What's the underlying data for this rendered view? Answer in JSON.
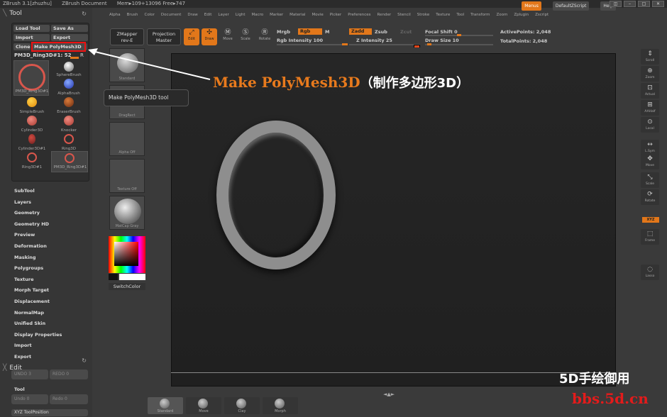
{
  "titlebar": {
    "app": "ZBrush 3.1[zhuzhu]",
    "doc": "ZBrush Document",
    "mem": "Mem▸109+13096 Free▸747"
  },
  "topright": {
    "menus": "Menus",
    "script": "DefaultZScript",
    "help": "Help"
  },
  "menubar": [
    "Alpha",
    "Brush",
    "Color",
    "Document",
    "Draw",
    "Edit",
    "Layer",
    "Light",
    "Macro",
    "Marker",
    "Material",
    "Movie",
    "Picker",
    "Preferences",
    "Render",
    "Stencil",
    "Stroke",
    "Texture",
    "Tool",
    "Transform",
    "Zoom",
    "Zplugin",
    "Zscript"
  ],
  "tool_panel": {
    "title": "Tool",
    "load": "Load Tool",
    "save": "Save As",
    "import": "Import",
    "export": "Export",
    "clone": "Clone",
    "make_polymesh": "Make PolyMesh3D",
    "current": "PM3D_Ring3D#1: 52",
    "r": "R",
    "thumb_label": "PM3D_Ring3D#1",
    "items": [
      {
        "label": "SphereBrush"
      },
      {
        "label": "AlphaBrush"
      },
      {
        "label": "SimpleBrush"
      },
      {
        "label": "EraserBrush"
      },
      {
        "label": "Cylinder3D"
      },
      {
        "label": "Knocker"
      },
      {
        "label": "Cylinder3D#1"
      },
      {
        "label": "Ring3D"
      },
      {
        "label": "Ring3D#1"
      },
      {
        "label": "PM3D_Ring3D#1"
      }
    ]
  },
  "tool_menu": [
    "SubTool",
    "Layers",
    "Geometry",
    "Geometry HD",
    "Preview",
    "Deformation",
    "Masking",
    "Polygroups",
    "Texture",
    "Morph Target",
    "Displacement",
    "NormalMap",
    "Unified Skin",
    "Display Properties",
    "Import",
    "Export"
  ],
  "edit_panel": {
    "title": "Edit",
    "undo": "UNDO 3",
    "redo": "REDO 0",
    "tool_head": "Tool",
    "undo2": "Undo 0",
    "redo2": "Redo 0",
    "xyz": "XYZ ToolPosition"
  },
  "shelf": [
    "Standard",
    "DragRect",
    "Alpha Off",
    "Texture Off",
    "MatCap Gray"
  ],
  "switchcolor": "SwitchColor",
  "toolbar": {
    "zmapper": "ZMapper",
    "zmapper2": "rev-E",
    "projection": "Projection",
    "projection2": "Master",
    "edit": "Edit",
    "draw": "Draw",
    "move": "Move",
    "scale": "Scale",
    "rotate": "Rotate",
    "mrgb": "Mrgb",
    "rgb": "Rgb",
    "m": "M",
    "rgb_intensity": "Rgb Intensity 100",
    "zadd": "Zadd",
    "zsub": "Zsub",
    "zcut": "Zcut",
    "z_intensity": "Z Intensity 25",
    "focal": "Focal Shift 0",
    "drawsize": "Draw Size 10",
    "active": "ActivePoints: 2,048",
    "total": "TotalPoints: 2,048"
  },
  "rightpanel": [
    "Scroll",
    "Zoom",
    "Actual",
    "AAHalf",
    "Local",
    "L.Sym",
    "Move",
    "Scale",
    "Rotate",
    "Frame",
    "Lasso"
  ],
  "xyz_btn": "XYZ",
  "bottombar": [
    "Standard",
    "Move",
    "Clay",
    "Morph"
  ],
  "tooltip": "Make PolyMesh3D tool",
  "annotation": {
    "en": "Make PolyMesh3D",
    "cn": "（制作多边形3D）"
  },
  "watermark": {
    "line1": "5D手绘御用",
    "line2": "bbs.5d.cn"
  },
  "colors": {
    "accent": "#e2771a",
    "annotation": "#e87a1d",
    "highlight": "#ee1111",
    "watermark_red": "#e31b1b"
  }
}
